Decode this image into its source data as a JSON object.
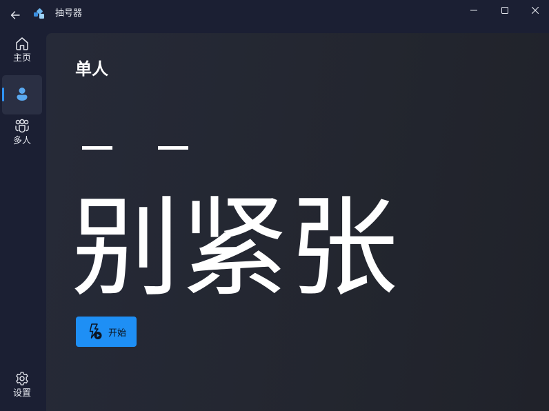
{
  "titlebar": {
    "title": "抽号器",
    "back_icon": "arrow-left-icon",
    "app_icon": "app-logo-icon",
    "controls": {
      "minimize": "minimize-icon",
      "maximize": "maximize-icon",
      "close": "close-icon"
    }
  },
  "nav": {
    "items": [
      {
        "id": "home",
        "label": "主页",
        "icon": "home-icon",
        "selected": false
      },
      {
        "id": "single",
        "label": "",
        "icon": "person-icon",
        "selected": true
      },
      {
        "id": "multi",
        "label": "多人",
        "icon": "people-group-icon",
        "selected": false
      }
    ],
    "footer": {
      "id": "settings",
      "label": "设置",
      "icon": "gear-icon"
    }
  },
  "main": {
    "title": "单人",
    "display_text": "别紧张",
    "start_button": {
      "label": "开始",
      "icon": "flash-play-icon"
    }
  },
  "colors": {
    "accent": "#1e8ff5",
    "window_bg": "#1b1f33",
    "content_bg": "#262a38",
    "nav_selected_bg": "#2a2f43",
    "text": "#ffffff"
  }
}
